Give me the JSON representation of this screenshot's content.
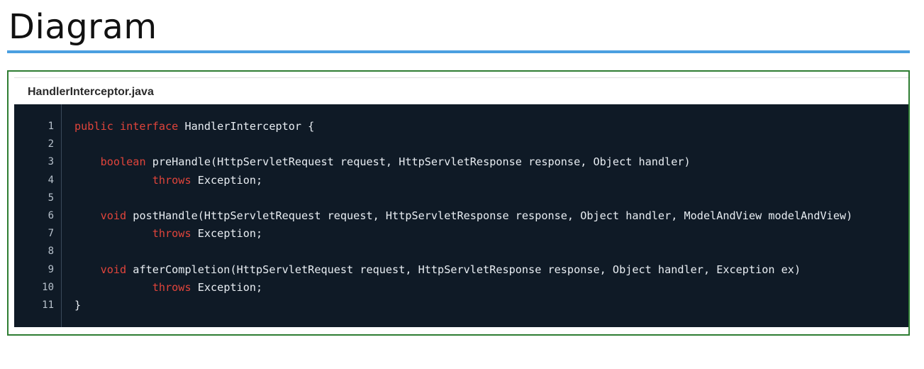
{
  "page": {
    "title": "Diagram"
  },
  "code_panel": {
    "file_name": "HandlerInterceptor.java",
    "lines": [
      {
        "num": "1",
        "indent": "",
        "kw": "public interface",
        "text": " HandlerInterceptor {"
      },
      {
        "num": "2",
        "indent": "",
        "kw": "",
        "text": ""
      },
      {
        "num": "3",
        "indent": "    ",
        "kw": "boolean",
        "text": " preHandle(HttpServletRequest request, HttpServletResponse response, Object handler)"
      },
      {
        "num": "4",
        "indent": "            ",
        "kw": "throws",
        "text": " Exception;"
      },
      {
        "num": "5",
        "indent": "",
        "kw": "",
        "text": ""
      },
      {
        "num": "6",
        "indent": "    ",
        "kw": "void",
        "text": " postHandle(HttpServletRequest request, HttpServletResponse response, Object handler, ModelAndView modelAndView)"
      },
      {
        "num": "7",
        "indent": "            ",
        "kw": "throws",
        "text": " Exception;"
      },
      {
        "num": "8",
        "indent": "",
        "kw": "",
        "text": ""
      },
      {
        "num": "9",
        "indent": "    ",
        "kw": "void",
        "text": " afterCompletion(HttpServletRequest request, HttpServletResponse response, Object handler, Exception ex)"
      },
      {
        "num": "10",
        "indent": "            ",
        "kw": "throws",
        "text": " Exception;"
      },
      {
        "num": "11",
        "indent": "",
        "kw": "",
        "text": "}"
      }
    ]
  }
}
